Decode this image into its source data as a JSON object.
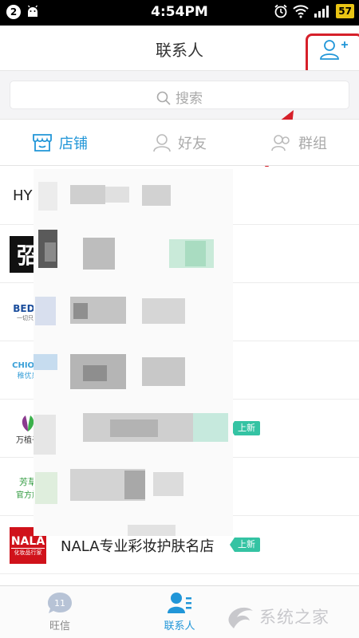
{
  "status_bar": {
    "notification_count": "2",
    "time": "4:54PM",
    "battery": "57"
  },
  "header": {
    "title": "联系人",
    "add_icon": "add-contact-icon"
  },
  "search": {
    "placeholder": "搜索"
  },
  "tabs": [
    {
      "label": "店铺",
      "icon": "shop-icon"
    },
    {
      "label": "好友",
      "icon": "friend-icon"
    },
    {
      "label": "群组",
      "icon": "group-icon"
    }
  ],
  "list": {
    "first_prefix": "HY",
    "tag_new": "上新",
    "avatars": {
      "row2": "弨",
      "row3_top": "BEDO",
      "row3_bottom": "一切只为",
      "row4_top": "CHIOIU",
      "row4_bottom": "稚优泉",
      "row5_bottom": "万植子",
      "row6_top": "芳草",
      "row6_bottom": "官方旗",
      "row7_top": "NALA",
      "row7_bottom": "化妆品行家"
    },
    "last_name": "NALA专业彩妆护肤名店"
  },
  "bottom_nav": [
    {
      "label": "旺信",
      "badge": "11"
    },
    {
      "label": "联系人"
    }
  ],
  "watermark": {
    "text": "系统之家"
  },
  "colors": {
    "accent": "#2196d8",
    "tag": "#34c3a3",
    "highlight": "#d6202a"
  }
}
